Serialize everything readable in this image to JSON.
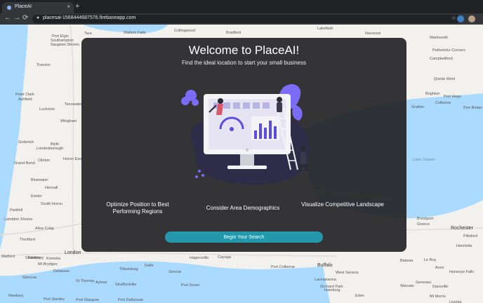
{
  "browser": {
    "tab_title": "PlaceAI",
    "tab_close": "×",
    "new_tab": "+",
    "url": "placesai-1568444687576.firebaseapp.com",
    "back": "←",
    "forward": "→",
    "reload": "⟳",
    "lock": "🔒",
    "star": "☆"
  },
  "map": {
    "labels": [
      {
        "text": "Tara",
        "cls": ""
      },
      {
        "text": "Walters Falls",
        "cls": ""
      },
      {
        "text": "Collingwood",
        "cls": ""
      },
      {
        "text": "Bradford",
        "cls": ""
      },
      {
        "text": "Lakefield",
        "cls": ""
      },
      {
        "text": "Norwood",
        "cls": ""
      },
      {
        "text": "Port Elgin",
        "cls": ""
      },
      {
        "text": "Southampton",
        "cls": ""
      },
      {
        "text": "Saugeen Shores",
        "cls": ""
      },
      {
        "text": "Warkworth",
        "cls": ""
      },
      {
        "text": "Pethericks Corners",
        "cls": ""
      },
      {
        "text": "Campbellford",
        "cls": ""
      },
      {
        "text": "Tiverton",
        "cls": ""
      },
      {
        "text": "Quinte West",
        "cls": ""
      },
      {
        "text": "Point Clark",
        "cls": ""
      },
      {
        "text": "Ashfield",
        "cls": ""
      },
      {
        "text": "Brighton",
        "cls": ""
      },
      {
        "text": "Lucknow",
        "cls": ""
      },
      {
        "text": "Teeswater",
        "cls": ""
      },
      {
        "text": "Grafton",
        "cls": ""
      },
      {
        "text": "Colborne",
        "cls": ""
      },
      {
        "text": "Port Hope",
        "cls": ""
      },
      {
        "text": "Port Britain",
        "cls": ""
      },
      {
        "text": "Wingham",
        "cls": ""
      },
      {
        "text": "Goderich",
        "cls": ""
      },
      {
        "text": "Blyth",
        "cls": ""
      },
      {
        "text": "Londesborough",
        "cls": ""
      },
      {
        "text": "Clinton",
        "cls": ""
      },
      {
        "text": "Huron East",
        "cls": ""
      },
      {
        "text": "Lake Ontario",
        "cls": "water"
      },
      {
        "text": "Grand Bend",
        "cls": ""
      },
      {
        "text": "Bluewater",
        "cls": ""
      },
      {
        "text": "Hensall",
        "cls": ""
      },
      {
        "text": "Exeter",
        "cls": ""
      },
      {
        "text": "South Huron",
        "cls": ""
      },
      {
        "text": "Lambton Shores",
        "cls": ""
      },
      {
        "text": "Parkhill",
        "cls": ""
      },
      {
        "text": "Ailsa Craig",
        "cls": ""
      },
      {
        "text": "Thedford",
        "cls": ""
      },
      {
        "text": "Strathroy",
        "cls": ""
      },
      {
        "text": "London",
        "cls": "big"
      },
      {
        "text": "Brockport",
        "cls": ""
      },
      {
        "text": "Greece",
        "cls": ""
      },
      {
        "text": "Rochester",
        "cls": "big"
      },
      {
        "text": "Pittsford",
        "cls": ""
      },
      {
        "text": "Henrietta",
        "cls": ""
      },
      {
        "text": "Watford",
        "cls": ""
      },
      {
        "text": "Strathroy",
        "cls": ""
      },
      {
        "text": "Komoka",
        "cls": ""
      },
      {
        "text": "Mt Brydges",
        "cls": ""
      },
      {
        "text": "Delaware",
        "cls": ""
      },
      {
        "text": "Hagersville",
        "cls": ""
      },
      {
        "text": "Cayuga",
        "cls": ""
      },
      {
        "text": "Port Colborne",
        "cls": ""
      },
      {
        "text": "Buffalo",
        "cls": "big"
      },
      {
        "text": "West Seneca",
        "cls": ""
      },
      {
        "text": "Batavia",
        "cls": ""
      },
      {
        "text": "Le Roy",
        "cls": ""
      },
      {
        "text": "Avon",
        "cls": ""
      },
      {
        "text": "Honeoye Falls",
        "cls": ""
      },
      {
        "text": "Tillsonburg",
        "cls": ""
      },
      {
        "text": "Delhi",
        "cls": ""
      },
      {
        "text": "Simcoe",
        "cls": ""
      },
      {
        "text": "St Thomas",
        "cls": ""
      },
      {
        "text": "Aylmer",
        "cls": ""
      },
      {
        "text": "Glencoe",
        "cls": ""
      },
      {
        "text": "Straffordville",
        "cls": ""
      },
      {
        "text": "Port Dover",
        "cls": ""
      },
      {
        "text": "Lackawanna",
        "cls": ""
      },
      {
        "text": "Orchard Park",
        "cls": ""
      },
      {
        "text": "Hamburg",
        "cls": ""
      },
      {
        "text": "Warsaw",
        "cls": ""
      },
      {
        "text": "Geneseo",
        "cls": ""
      },
      {
        "text": "Dansville",
        "cls": ""
      },
      {
        "text": "Newbury",
        "cls": ""
      },
      {
        "text": "Port Stanley",
        "cls": ""
      },
      {
        "text": "Port Glasgow",
        "cls": ""
      },
      {
        "text": "Port Dalhousie",
        "cls": ""
      },
      {
        "text": "Eden",
        "cls": ""
      },
      {
        "text": "Mt Morris",
        "cls": ""
      },
      {
        "text": "Livonia",
        "cls": ""
      }
    ]
  },
  "modal": {
    "title": "Welcome to PlaceAI!",
    "subtitle": "Find the ideal location to start your small business",
    "features": [
      "Optimize Position to Best\nPerforming Regions",
      "Consider Area Demographics",
      "Visualize Competitive Landscape"
    ],
    "cta_label": "Begin Your Search"
  },
  "colors": {
    "accent": "#2597ad",
    "modal_bg": "#242426",
    "illustration_purple": "#7b6cf6",
    "browser_dark": "#202124"
  }
}
